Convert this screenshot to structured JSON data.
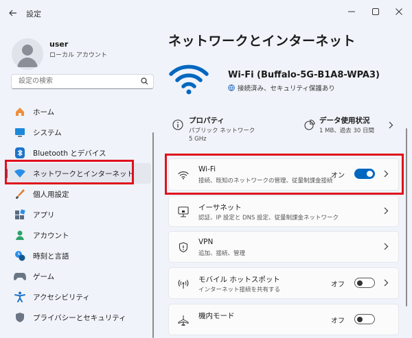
{
  "window": {
    "title": "設定"
  },
  "user": {
    "name": "user",
    "account_type": "ローカル アカウント"
  },
  "search": {
    "placeholder": "設定の検索"
  },
  "nav": [
    {
      "label": "ホーム",
      "icon": "home-icon"
    },
    {
      "label": "システム",
      "icon": "system-icon"
    },
    {
      "label": "Bluetooth とデバイス",
      "icon": "bluetooth-icon"
    },
    {
      "label": "ネットワークとインターネット",
      "icon": "network-icon",
      "active": true
    },
    {
      "label": "個人用設定",
      "icon": "brush-icon"
    },
    {
      "label": "アプリ",
      "icon": "apps-icon"
    },
    {
      "label": "アカウント",
      "icon": "account-icon"
    },
    {
      "label": "時刻と言語",
      "icon": "time-language-icon"
    },
    {
      "label": "ゲーム",
      "icon": "gaming-icon"
    },
    {
      "label": "アクセシビリティ",
      "icon": "accessibility-icon"
    },
    {
      "label": "プライバシーとセキュリティ",
      "icon": "privacy-icon"
    }
  ],
  "main": {
    "title": "ネットワークとインターネット",
    "connection": {
      "name": "Wi-Fi (Buffalo-5G-B1A8-WPA3)",
      "status": "接続済み、セキュリティ保護あり"
    },
    "properties": {
      "title": "プロパティ",
      "sub1": "パブリック ネットワーク",
      "sub2": "5 GHz"
    },
    "data_usage": {
      "title": "データ使用状況",
      "sub": "1 MB、過去 30 日間"
    },
    "cards": [
      {
        "title": "Wi-Fi",
        "subtitle": "接続、既知のネットワークの管理、従量制課金接続",
        "toggle": "オン"
      },
      {
        "title": "イーサネット",
        "subtitle": "認証、IP 設定と DNS 設定、従量制課金ネットワーク"
      },
      {
        "title": "VPN",
        "subtitle": "追加、接続、管理"
      },
      {
        "title": "モバイル ホットスポット",
        "subtitle": "インターネット接続を共有する",
        "toggle": "オフ"
      },
      {
        "title": "機内モード",
        "toggle": "オフ"
      }
    ]
  },
  "colors": {
    "accent": "#0067c0",
    "highlight": "#e0101c",
    "background": "#f0f3f9"
  }
}
